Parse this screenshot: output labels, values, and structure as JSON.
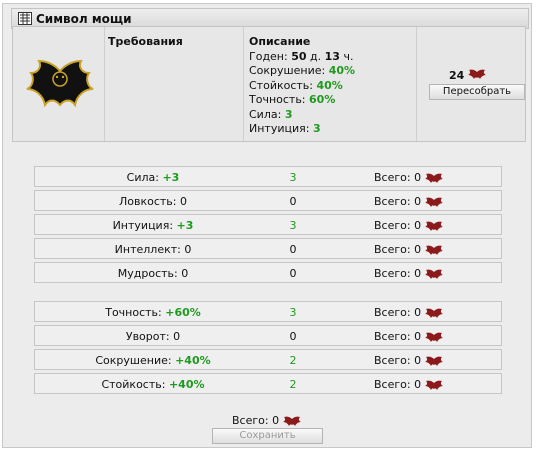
{
  "window": {
    "title": "Символ мощи",
    "title_icon": "bat-grid-icon"
  },
  "info": {
    "requirements_header": "Требования",
    "description_header": "Описание",
    "durability": {
      "label": "Годен:",
      "cur": "50",
      "sep": "д.",
      "max": "13",
      "unit": "ч."
    },
    "props": [
      {
        "label": "Сокрушение:",
        "value": "40%"
      },
      {
        "label": "Стойкость:",
        "value": "40%"
      },
      {
        "label": "Точность:",
        "value": "60%"
      },
      {
        "label": "Сила:",
        "value": "3"
      },
      {
        "label": "Интуиция:",
        "value": "3"
      }
    ],
    "price": "24",
    "price_icon": "bat-currency-icon",
    "rebuild_button": "Пересобрать"
  },
  "stats_group1": [
    {
      "name": "Сила:",
      "bonus": "+3",
      "value": "3",
      "total": "Всего: 0"
    },
    {
      "name": "Ловкость:",
      "bonus": "0",
      "value": "0",
      "total": "Всего: 0"
    },
    {
      "name": "Интуиция:",
      "bonus": "+3",
      "value": "3",
      "total": "Всего: 0"
    },
    {
      "name": "Интеллект:",
      "bonus": "0",
      "value": "0",
      "total": "Всего: 0"
    },
    {
      "name": "Мудрость:",
      "bonus": "0",
      "value": "0",
      "total": "Всего: 0"
    }
  ],
  "stats_group2": [
    {
      "name": "Точность:",
      "bonus": "+60%",
      "value": "3",
      "total": "Всего: 0"
    },
    {
      "name": "Уворот:",
      "bonus": "0",
      "value": "0",
      "total": "Всего: 0"
    },
    {
      "name": "Сокрушение:",
      "bonus": "+40%",
      "value": "2",
      "total": "Всего: 0"
    },
    {
      "name": "Стойкость:",
      "bonus": "+40%",
      "value": "2",
      "total": "Всего: 0"
    }
  ],
  "footer": {
    "total": "Всего: 0",
    "save_button": "Сохранить"
  },
  "colors": {
    "bonus_green": "#1e9b1e",
    "bat_red": "#8b1a1a",
    "item_gold": "#c9a227"
  }
}
